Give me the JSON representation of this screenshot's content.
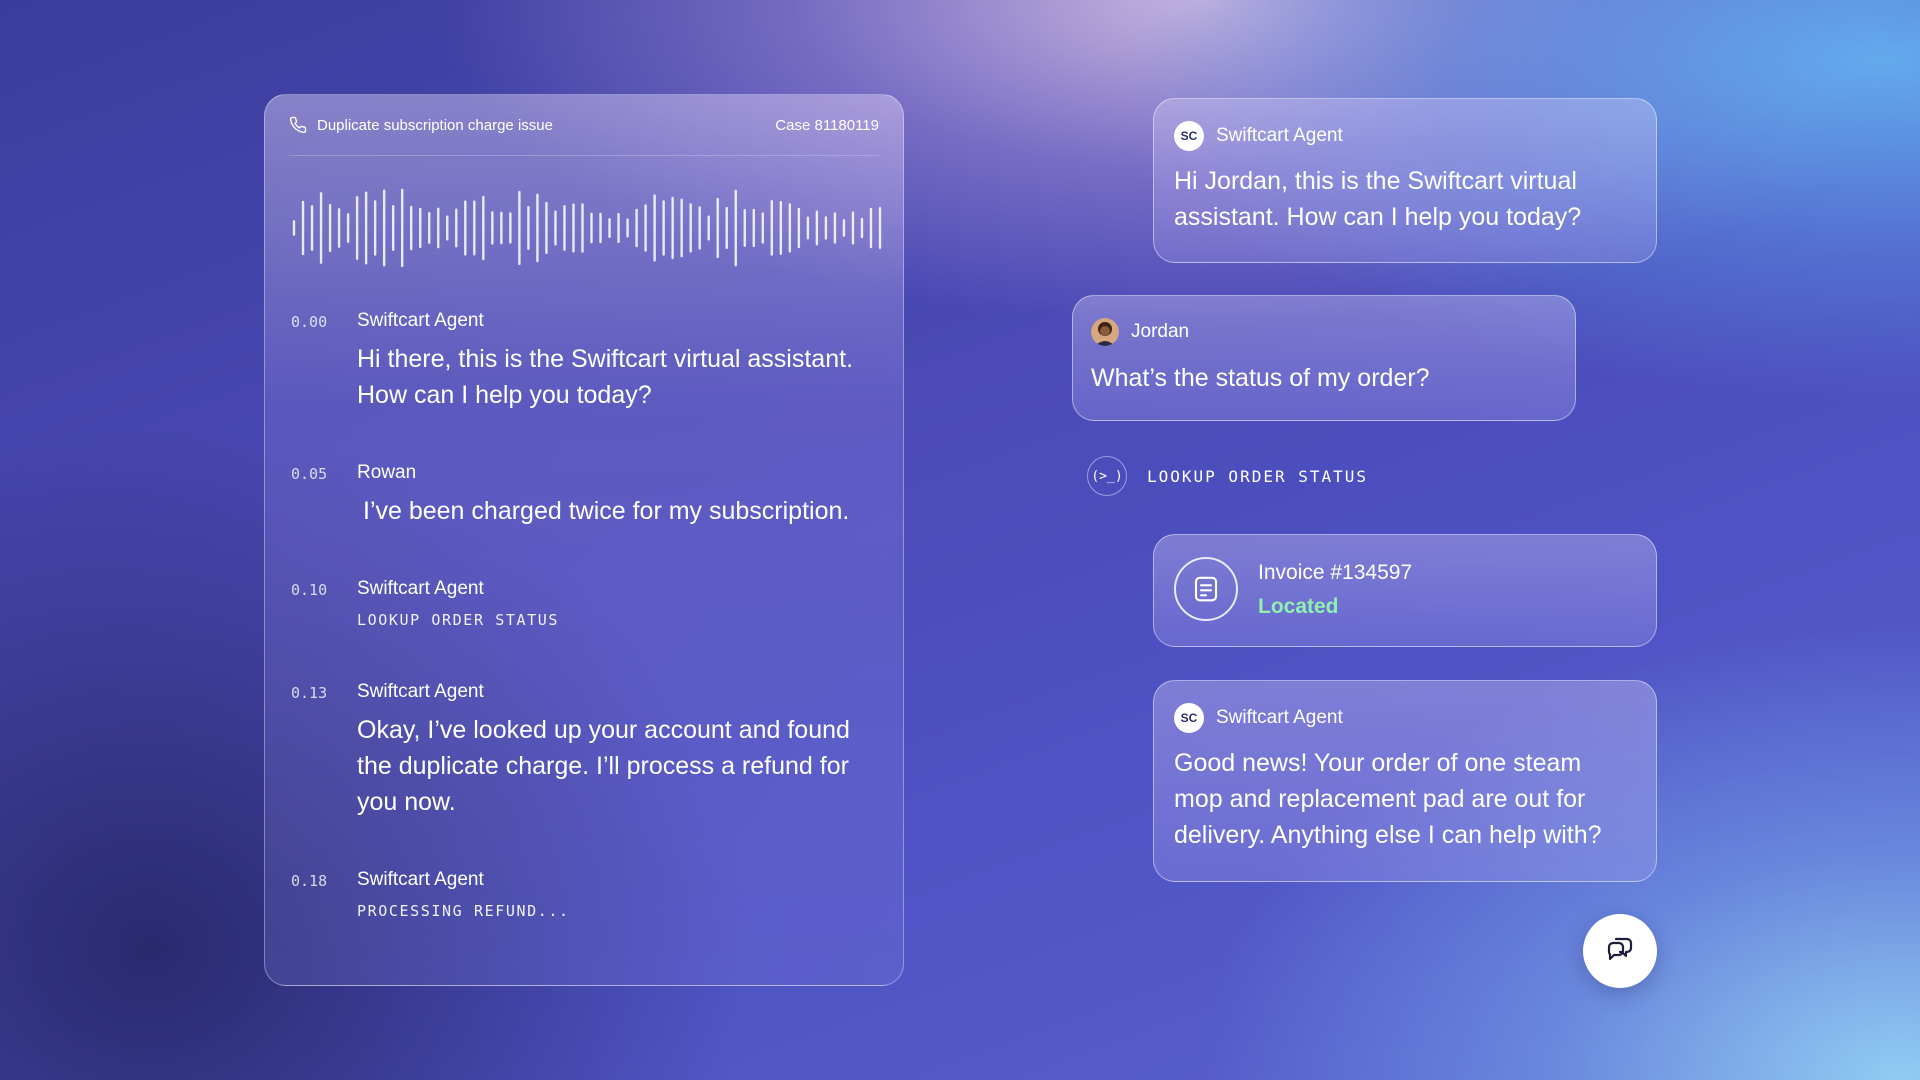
{
  "transcript": {
    "title": "Duplicate subscription charge issue",
    "case": "Case 81180119",
    "entries": [
      {
        "time": "0.00",
        "speaker": "Swiftcart Agent",
        "text": "Hi there, this is the Swiftcart virtual assistant. How can I help you today?"
      },
      {
        "time": "0.05",
        "speaker": "Rowan",
        "text": "I’ve been charged twice for my subscription."
      },
      {
        "time": "0.10",
        "speaker": "Swiftcart Agent",
        "action": "LOOKUP ORDER STATUS"
      },
      {
        "time": "0.13",
        "speaker": "Swiftcart Agent",
        "text": "Okay, I’ve looked up your account and found the duplicate charge. I’ll process a refund for you now."
      },
      {
        "time": "0.18",
        "speaker": "Swiftcart Agent",
        "action": "PROCESSING REFUND..."
      }
    ]
  },
  "chat": {
    "agent_initials": "SC",
    "messages": [
      {
        "sender": "Swiftcart Agent",
        "text": "Hi Jordan, this is the Swiftcart virtual assistant. How can I help you today?"
      },
      {
        "sender": "Jordan",
        "text": "What’s the status of my order?"
      },
      {
        "sender": "Swiftcart Agent",
        "text": "Good news! Your order of one steam mop and replacement pad are out for delivery. Anything else I can help with?"
      }
    ],
    "tool_call": {
      "icon_text": "(>_)",
      "label": "LOOKUP ORDER STATUS"
    },
    "invoice": {
      "title": "Invoice #134597",
      "status": "Located",
      "status_color": "#8ff0b0"
    }
  },
  "icons": {
    "phone": "phone-icon",
    "invoice": "document-icon",
    "fab": "chat-bubbles-icon"
  }
}
